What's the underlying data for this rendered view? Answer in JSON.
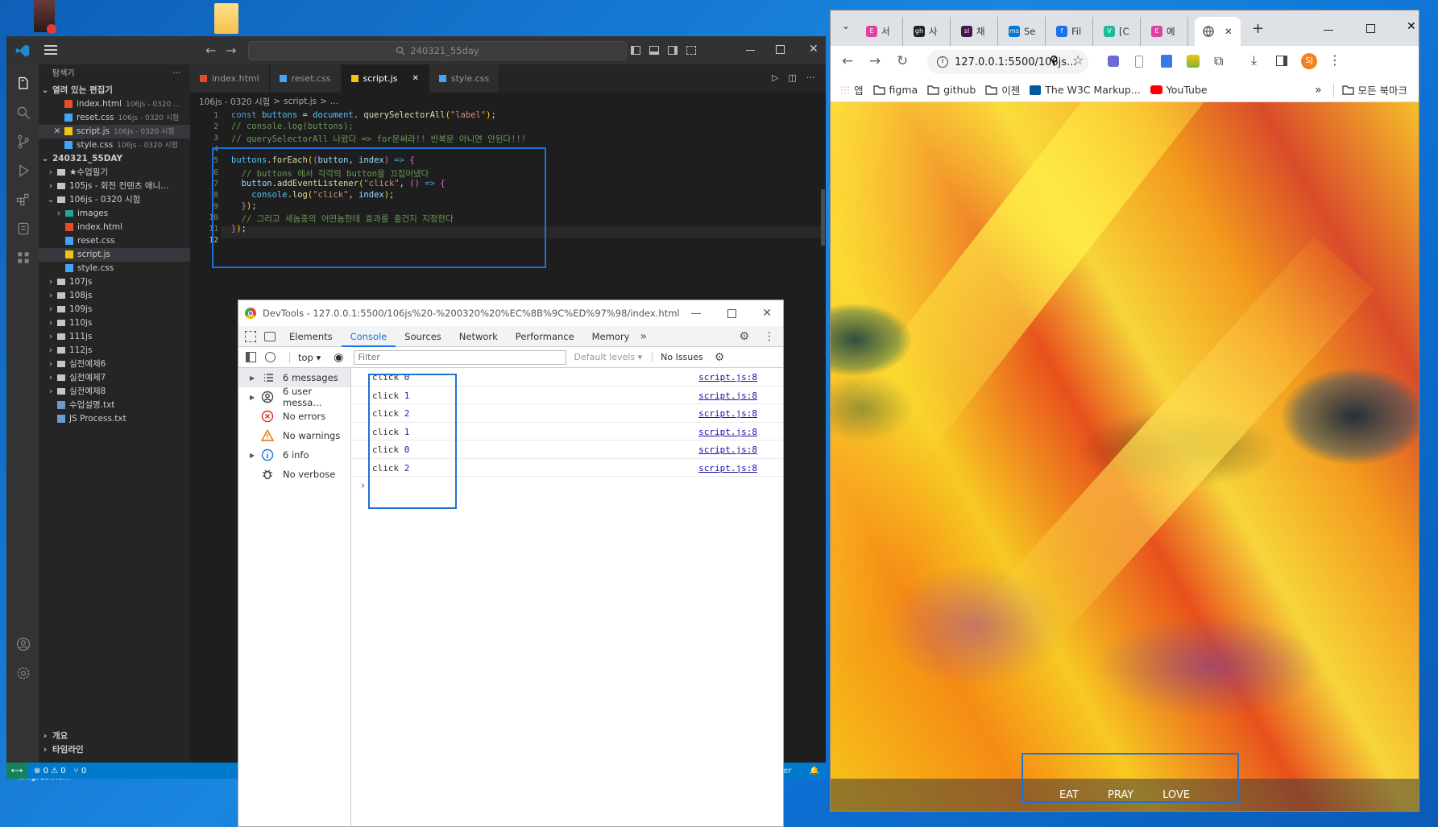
{
  "vscode": {
    "search_text": "240321_55day",
    "explorer_label": "탐색기",
    "open_editors_label": "열려 있는 편집기",
    "open_editors": [
      {
        "name": "index.html",
        "desc": "106js - 0320 ...",
        "icon_color": "#e44d26"
      },
      {
        "name": "reset.css",
        "desc": "106js - 0320 시험",
        "icon_color": "#42a5f5"
      },
      {
        "name": "script.js",
        "desc": "106js - 0320 시험",
        "icon_color": "#f1c40f",
        "close": "✕"
      },
      {
        "name": "style.css",
        "desc": "106js - 0320 시험",
        "icon_color": "#42a5f5"
      }
    ],
    "workspace_label": "240321_55DAY",
    "tree": [
      {
        "name": "★수업필기",
        "kind": "folder",
        "depth": 1
      },
      {
        "name": "105js - 회전 컨텐츠 애니...",
        "kind": "folder",
        "depth": 1
      },
      {
        "name": "106js - 0320 시험",
        "kind": "folder",
        "depth": 1,
        "open": true
      },
      {
        "name": "images",
        "kind": "folder",
        "depth": 2
      },
      {
        "name": "index.html",
        "kind": "html",
        "depth": 2
      },
      {
        "name": "reset.css",
        "kind": "css",
        "depth": 2
      },
      {
        "name": "script.js",
        "kind": "js",
        "depth": 2,
        "selected": true
      },
      {
        "name": "style.css",
        "kind": "css",
        "depth": 2
      },
      {
        "name": "107js",
        "kind": "folder",
        "depth": 1
      },
      {
        "name": "108js",
        "kind": "folder",
        "depth": 1
      },
      {
        "name": "109js",
        "kind": "folder",
        "depth": 1
      },
      {
        "name": "110js",
        "kind": "folder",
        "depth": 1
      },
      {
        "name": "111js",
        "kind": "folder",
        "depth": 1
      },
      {
        "name": "112js",
        "kind": "folder",
        "depth": 1
      },
      {
        "name": "실전예제6",
        "kind": "folder",
        "depth": 1
      },
      {
        "name": "실전예제7",
        "kind": "folder",
        "depth": 1
      },
      {
        "name": "실전예제8",
        "kind": "folder",
        "depth": 1
      },
      {
        "name": "수업설명.txt",
        "kind": "txt",
        "depth": 1
      },
      {
        "name": "JS Process.txt",
        "kind": "txt",
        "depth": 1
      }
    ],
    "outline_label": "개요",
    "timeline_label": "타임라인",
    "tabs": [
      {
        "name": "index.html",
        "color": "#e44d26"
      },
      {
        "name": "reset.css",
        "color": "#42a5f5"
      },
      {
        "name": "script.js",
        "color": "#f1c40f",
        "active": true,
        "close": "✕"
      },
      {
        "name": "style.css",
        "color": "#42a5f5"
      }
    ],
    "breadcrumb": [
      "106js - 0320 시험",
      ">",
      "script.js",
      ">",
      "..."
    ],
    "status": {
      "errors": "0",
      "warnings": "0",
      "ports": "0",
      "right": "tier"
    },
    "line_numbers": [
      "1",
      "2",
      "3",
      "4",
      "5",
      "6",
      "7",
      "8",
      "9",
      "10",
      "11",
      "12"
    ]
  },
  "code_lines": [
    {
      "parts": [
        [
          "kw",
          "const "
        ],
        [
          "vr",
          "buttons"
        ],
        [
          "",
          " = "
        ],
        [
          "vr",
          "document"
        ],
        [
          "",
          ". "
        ],
        [
          "fn",
          "querySelectorAll"
        ],
        [
          "br",
          "("
        ],
        [
          "st",
          "\"label\""
        ],
        [
          "br",
          ")"
        ],
        [
          "",
          ";"
        ]
      ]
    },
    {
      "parts": [
        [
          "cm",
          "// console.log(buttons);"
        ]
      ]
    },
    {
      "parts": [
        [
          "cm",
          "// querySelectorAll 나왔다 => for문써라!! 반복문 아니면 안된다!!!"
        ]
      ]
    },
    {
      "parts": []
    },
    {
      "parts": [
        [
          "vr",
          "buttons"
        ],
        [
          "",
          "."
        ],
        [
          "fn",
          "forEach"
        ],
        [
          "br",
          "("
        ],
        [
          "br2",
          "("
        ],
        [
          "pm",
          "button"
        ],
        [
          "",
          ", "
        ],
        [
          "pm",
          "index"
        ],
        [
          "br2",
          ")"
        ],
        [
          "kw",
          " => "
        ],
        [
          "br2",
          "{"
        ]
      ]
    },
    {
      "parts": [
        [
          "",
          "  "
        ],
        [
          "cm",
          "// buttons 에서 각각의 button을 끄집어냈다"
        ]
      ]
    },
    {
      "parts": [
        [
          "",
          "  "
        ],
        [
          "pm",
          "button"
        ],
        [
          "",
          "."
        ],
        [
          "fn",
          "addEventListener"
        ],
        [
          "br",
          "("
        ],
        [
          "st",
          "\"click\""
        ],
        [
          "",
          ", "
        ],
        [
          "br2",
          "("
        ],
        [
          "br2",
          ")"
        ],
        [
          "kw",
          " => "
        ],
        [
          "br2",
          "{"
        ]
      ]
    },
    {
      "parts": [
        [
          "",
          "    "
        ],
        [
          "vr",
          "console"
        ],
        [
          "",
          "."
        ],
        [
          "fn",
          "log"
        ],
        [
          "br",
          "("
        ],
        [
          "st",
          "\"click\""
        ],
        [
          "",
          ", "
        ],
        [
          "pm",
          "index"
        ],
        [
          "br",
          ")"
        ],
        [
          "",
          ";"
        ]
      ]
    },
    {
      "parts": [
        [
          "",
          "  "
        ],
        [
          "br2",
          "}"
        ],
        [
          "br",
          ")"
        ],
        [
          "",
          ";"
        ]
      ]
    },
    {
      "parts": [
        [
          "",
          "  "
        ],
        [
          "cm",
          "// 그리고 세놈중의 어떤놈한테 효과를 줄건지 지정한다"
        ]
      ]
    },
    {
      "parts": [
        [
          "br2",
          "}"
        ],
        [
          "br",
          ")"
        ],
        [
          "",
          ";"
        ]
      ]
    },
    {
      "parts": []
    }
  ],
  "devtools": {
    "title": "DevTools - 127.0.0.1:5500/106js%20-%200320%20%EC%8B%9C%ED%97%98/index.html",
    "tabs": [
      "Elements",
      "Console",
      "Sources",
      "Network",
      "Performance",
      "Memory"
    ],
    "active_tab": "Console",
    "context": "top",
    "filter_placeholder": "Filter",
    "levels": "Default levels",
    "issues": "No Issues",
    "sidebar": [
      {
        "label": "6 messages",
        "icon": "list-icon",
        "expand": true,
        "selected": true
      },
      {
        "label": "6 user messa...",
        "icon": "user-icon",
        "expand": true
      },
      {
        "label": "No errors",
        "icon": "error-icon"
      },
      {
        "label": "No warnings",
        "icon": "warning-icon"
      },
      {
        "label": "6 info",
        "icon": "info-icon",
        "expand": true
      },
      {
        "label": "No verbose",
        "icon": "bug-icon"
      }
    ],
    "messages": [
      {
        "text": "click",
        "num": "0",
        "src": "script.js:8"
      },
      {
        "text": "click",
        "num": "1",
        "src": "script.js:8"
      },
      {
        "text": "click",
        "num": "2",
        "src": "script.js:8"
      },
      {
        "text": "click",
        "num": "1",
        "src": "script.js:8"
      },
      {
        "text": "click",
        "num": "0",
        "src": "script.js:8"
      },
      {
        "text": "click",
        "num": "2",
        "src": "script.js:8"
      }
    ],
    "prompt": "›"
  },
  "chrome": {
    "tabs": [
      {
        "label": "서",
        "icon_color": "#e040a0",
        "icon_text": "E"
      },
      {
        "label": "사",
        "icon_color": "#222",
        "icon_text": "gh"
      },
      {
        "label": "채",
        "icon_color": "#4a154b",
        "icon_text": "sl"
      },
      {
        "label": "Se",
        "icon_color": "#0078d4",
        "icon_text": "ms"
      },
      {
        "label": "Fil",
        "icon_color": "#1a73e8",
        "icon_text": "f"
      },
      {
        "label": "[C",
        "icon_color": "#1abc9c",
        "icon_text": "V"
      },
      {
        "label": "예",
        "icon_color": "#e040a0",
        "icon_text": "E"
      }
    ],
    "url": "127.0.0.1:5500/106js...",
    "profile": "SJ",
    "bookmarks": [
      {
        "label": "앱",
        "icon": "apps-icon"
      },
      {
        "label": "figma",
        "icon": "folder-icon"
      },
      {
        "label": "github",
        "icon": "folder-icon"
      },
      {
        "label": "이젠",
        "icon": "folder-icon"
      },
      {
        "label": "The W3C Markup...",
        "icon": "w3c-icon"
      },
      {
        "label": "YouTube",
        "icon": "youtube-icon"
      }
    ],
    "more_bookmarks": "»",
    "all_bookmarks": "모든 북마크",
    "page_buttons": [
      "EAT",
      "PRAY",
      "LOVE"
    ]
  },
  "desktop": {
    "taskbar_item": "imgres.htm"
  },
  "colors": {
    "highlight": "#1e72d6",
    "vscode_accent": "#007acc",
    "devtools_accent": "#1a73e8"
  }
}
